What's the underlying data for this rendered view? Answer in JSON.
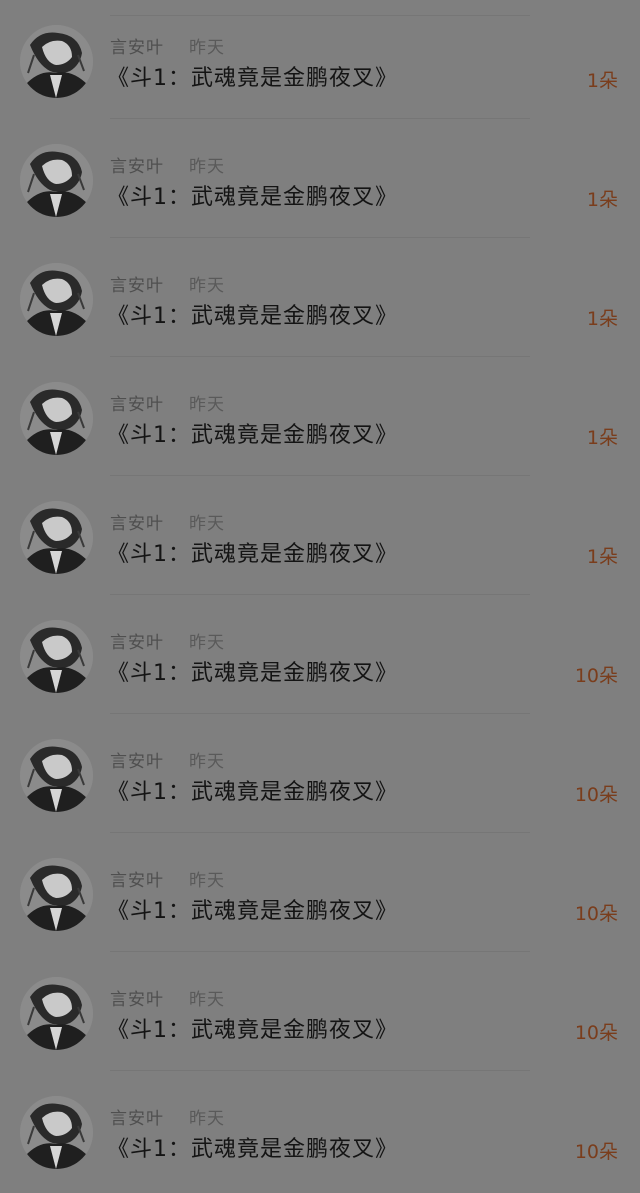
{
  "gifts": [
    {
      "author": "言安叶",
      "time": "昨天",
      "title": "《斗1：武魂竟是金鹏夜叉》",
      "count": "1朵"
    },
    {
      "author": "言安叶",
      "time": "昨天",
      "title": "《斗1：武魂竟是金鹏夜叉》",
      "count": "1朵"
    },
    {
      "author": "言安叶",
      "time": "昨天",
      "title": "《斗1：武魂竟是金鹏夜叉》",
      "count": "1朵"
    },
    {
      "author": "言安叶",
      "time": "昨天",
      "title": "《斗1：武魂竟是金鹏夜叉》",
      "count": "1朵"
    },
    {
      "author": "言安叶",
      "time": "昨天",
      "title": "《斗1：武魂竟是金鹏夜叉》",
      "count": "1朵"
    },
    {
      "author": "言安叶",
      "time": "昨天",
      "title": "《斗1：武魂竟是金鹏夜叉》",
      "count": "10朵"
    },
    {
      "author": "言安叶",
      "time": "昨天",
      "title": "《斗1：武魂竟是金鹏夜叉》",
      "count": "10朵"
    },
    {
      "author": "言安叶",
      "time": "昨天",
      "title": "《斗1：武魂竟是金鹏夜叉》",
      "count": "10朵"
    },
    {
      "author": "言安叶",
      "time": "昨天",
      "title": "《斗1：武魂竟是金鹏夜叉》",
      "count": "10朵"
    },
    {
      "author": "言安叶",
      "time": "昨天",
      "title": "《斗1：武魂竟是金鹏夜叉》",
      "count": "10朵"
    }
  ],
  "colors": {
    "background": "#7f7f7f",
    "count_color": "#7a3d1c",
    "title_color": "#141414",
    "meta_color": "#4f4f4f"
  }
}
